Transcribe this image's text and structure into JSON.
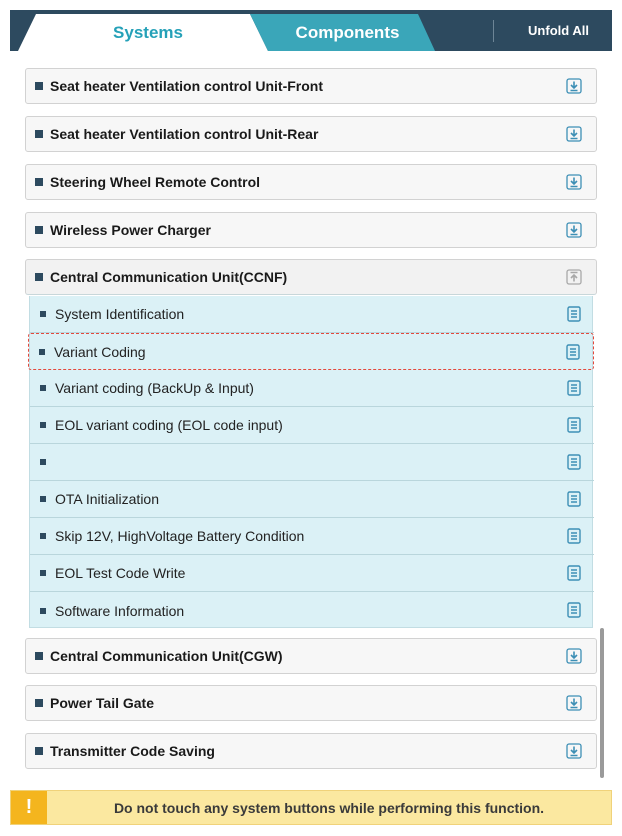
{
  "header": {
    "tab_systems": "Systems",
    "tab_components": "Components",
    "unfold_all": "Unfold All"
  },
  "systems": [
    {
      "label": "Seat heater Ventilation control Unit-Front",
      "state": "collapsed",
      "icon": "download-icon"
    },
    {
      "label": "Seat heater Ventilation control Unit-Rear",
      "state": "collapsed",
      "icon": "download-icon"
    },
    {
      "label": "Steering Wheel Remote Control",
      "state": "collapsed",
      "icon": "download-icon"
    },
    {
      "label": "Wireless Power Charger",
      "state": "collapsed",
      "icon": "download-icon"
    },
    {
      "label": "Central Communication Unit(CCNF)",
      "state": "expanded",
      "icon": "upload-icon",
      "functions": [
        {
          "label": "System Identification"
        },
        {
          "label": "Variant Coding",
          "selected": true
        },
        {
          "label": "Variant coding (BackUp & Input)"
        },
        {
          "label": "EOL variant coding (EOL code input)"
        },
        {
          "label": ""
        },
        {
          "label": "OTA Initialization"
        },
        {
          "label": "Skip 12V, HighVoltage Battery Condition"
        },
        {
          "label": "EOL Test Code Write"
        },
        {
          "label": "Software Information"
        }
      ]
    },
    {
      "label": "Central Communication Unit(CGW)",
      "state": "collapsed",
      "icon": "download-icon"
    },
    {
      "label": "Power Tail Gate",
      "state": "collapsed",
      "icon": "download-icon"
    },
    {
      "label": "Transmitter Code Saving",
      "state": "collapsed",
      "icon": "download-icon"
    }
  ],
  "warning": {
    "icon": "!",
    "text": "Do not touch any system buttons while performing this function."
  },
  "colors": {
    "header_bg": "#2d4a5f",
    "tab_active_text": "#25a1b8",
    "tab_inactive_bg": "#3aa6b9",
    "sub_panel_bg": "#dbf1f6",
    "warning_bg": "#fbe8a0",
    "warning_icon_bg": "#f4b51e",
    "selection_border": "#e3483c"
  }
}
